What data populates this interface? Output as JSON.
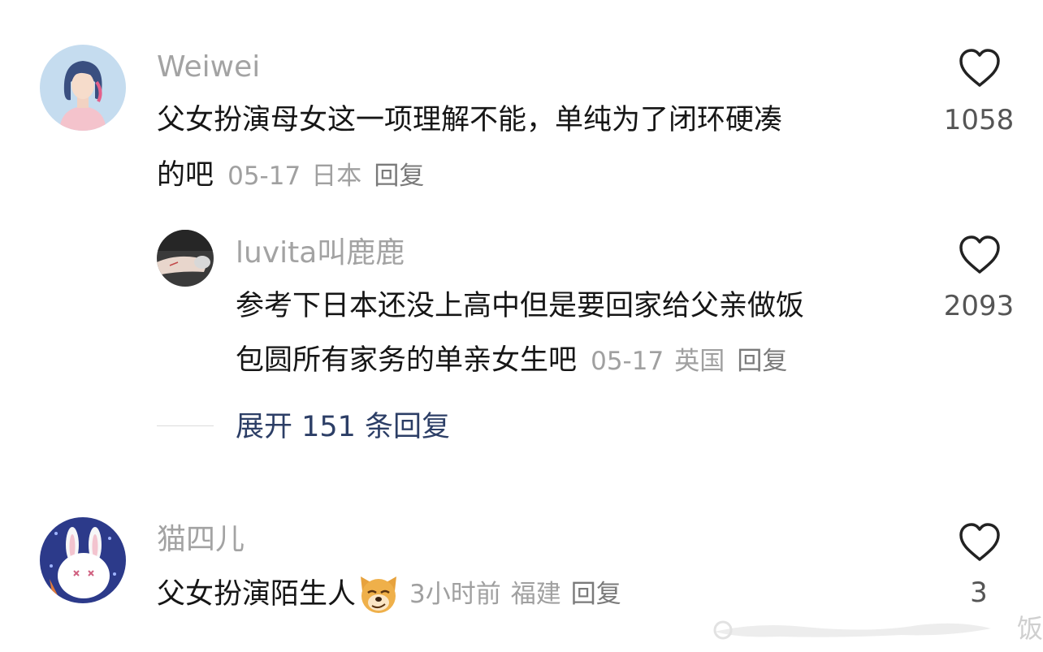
{
  "comments": [
    {
      "username": "Weiwei",
      "text_line1": "父女扮演母女这一项理解不能，单纯为了闭环硬凑",
      "text_line2": "的吧",
      "date": "05-17",
      "location": "日本",
      "reply_label": "回复",
      "likes": "1058",
      "avatar": "woman-portrait-avatar"
    },
    {
      "username": "luvita叫鹿鹿",
      "text_line1": "参考下日本还没上高中但是要回家给父亲做饭",
      "text_line2": "包圆所有家务的单亲女生吧",
      "date": "05-17",
      "location": "英国",
      "reply_label": "回复",
      "likes": "2093",
      "avatar": "arm-photo-avatar"
    },
    {
      "username": "猫四儿",
      "text": "父女扮演陌生人",
      "emoji": "smirking-dog-emoji",
      "time": "3小时前",
      "location": "福建",
      "reply_label": "回复",
      "likes": "3",
      "avatar": "white-rabbit-avatar"
    }
  ],
  "expand_replies": "展开 151 条回复",
  "watermark": "饭",
  "colors": {
    "username": "#a3a3a3",
    "body_text": "#161616",
    "meta": "#a0a0a0",
    "expand_link": "#2c3e66",
    "heart_outline": "#222222"
  }
}
